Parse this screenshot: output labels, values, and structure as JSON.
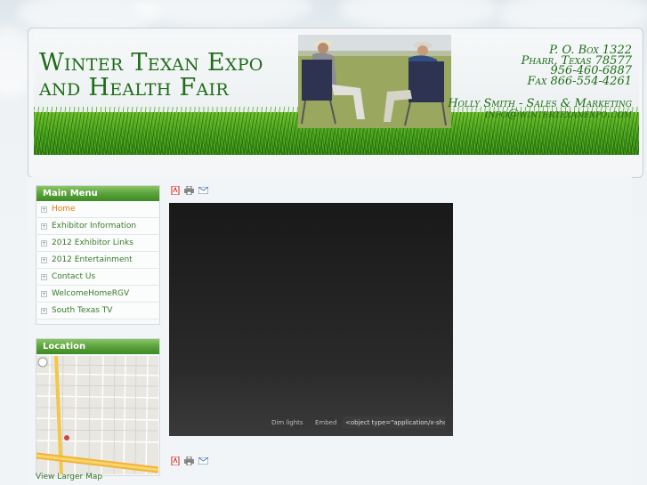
{
  "header": {
    "title_lines": [
      "Winter Texan Expo",
      "and Health Fair"
    ],
    "contact_lines": [
      "P. O. Box 1322",
      "Pharr, Texas  78577",
      "956-460-6887",
      "Fax 866-554-4261"
    ],
    "sales_lines": [
      "Holly Smith - Sales & Marketing",
      "info@wintertexanexpo.com"
    ]
  },
  "main_menu": {
    "title": "Main Menu",
    "items": [
      {
        "label": "Home",
        "active": true
      },
      {
        "label": "Exhibitor Information"
      },
      {
        "label": "2012 Exhibitor Links"
      },
      {
        "label": "2012 Entertainment"
      },
      {
        "label": "Contact Us"
      },
      {
        "label": "WelcomeHomeRGV"
      },
      {
        "label": "South Texas TV"
      }
    ]
  },
  "location": {
    "title": "Location",
    "larger_map": "View Larger Map"
  },
  "article_icons": [
    "pdf-icon",
    "print-icon",
    "email-icon"
  ],
  "video": {
    "dim_lights": "Dim lights",
    "embed": "Embed",
    "embed_code": "<object type=\"application/x-shoc"
  },
  "colors": {
    "brand_green": "#1f6b18",
    "menu_header": "#5aa23a",
    "link": "#3a7a2b",
    "active_link": "#e07a10"
  }
}
